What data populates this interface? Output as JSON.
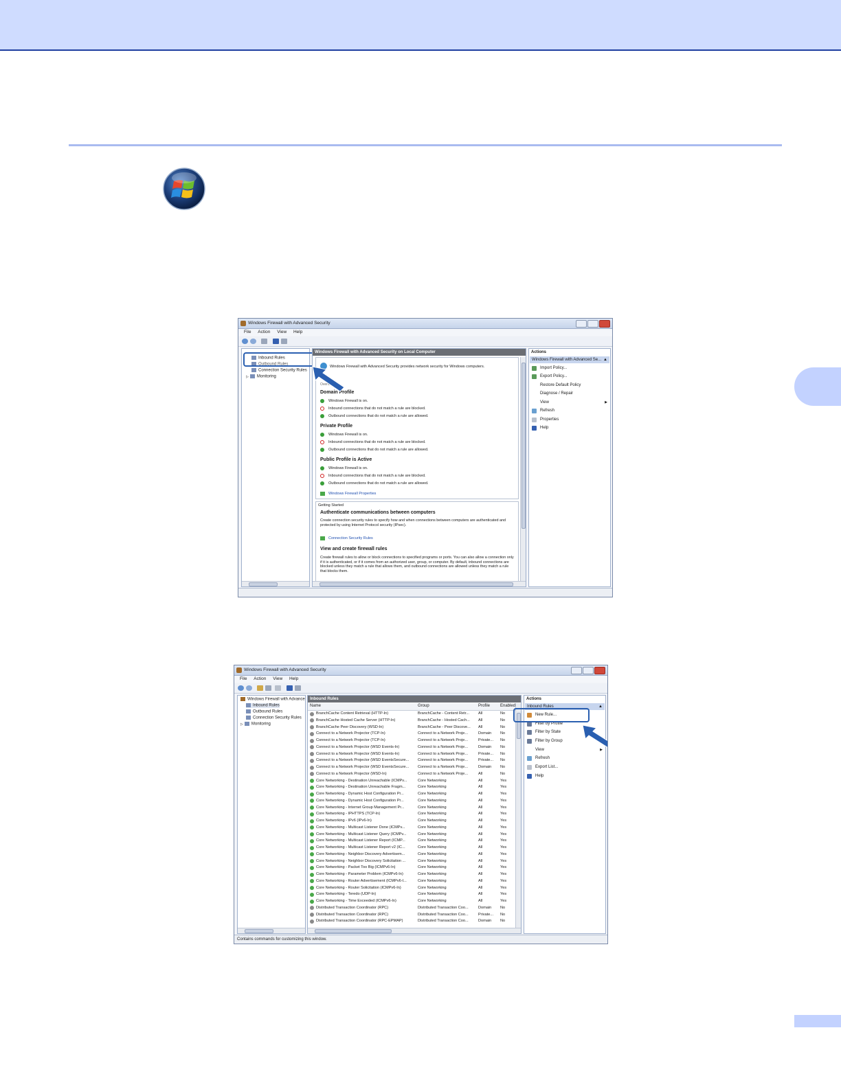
{
  "screenshot1": {
    "title": "Windows Firewall with Advanced Security",
    "menu": [
      "File",
      "Action",
      "View",
      "Help"
    ],
    "tree": {
      "inbound": "Inbound Rules",
      "outbound": "Outbound Rules",
      "connection": "Connection Security Rules",
      "monitoring": "Monitoring"
    },
    "center_header": "Windows Firewall with Advanced Security on Local Computer",
    "overview_intro": "Windows Firewall with Advanced Security provides network security for Windows computers.",
    "overview_label": "Overview",
    "profiles": [
      {
        "name": "Domain Profile",
        "lines": [
          "Windows Firewall is on.",
          "Inbound connections that do not match a rule are blocked.",
          "Outbound connections that do not match a rule are allowed."
        ]
      },
      {
        "name": "Private Profile",
        "lines": [
          "Windows Firewall is on.",
          "Inbound connections that do not match a rule are blocked.",
          "Outbound connections that do not match a rule are allowed."
        ]
      },
      {
        "name": "Public Profile is Active",
        "lines": [
          "Windows Firewall is on.",
          "Inbound connections that do not match a rule are blocked.",
          "Outbound connections that do not match a rule are allowed."
        ]
      }
    ],
    "properties_link": "Windows Firewall Properties",
    "getting_started": "Getting Started",
    "auth_title": "Authenticate communications between computers",
    "auth_text": "Create connection security rules to specify how and when connections between computers are authenticated and protected by using Internet Protocol security (IPsec).",
    "conn_link": "Connection Security Rules",
    "view_title": "View and create firewall rules",
    "view_text": "Create firewall rules to allow or block connections to specified programs or ports. You can also allow a connection only if it is authenticated, or if it comes from an authorized user, group, or computer. By default, inbound connections are blocked unless they match a rule that allows them, and outbound connections are allowed unless they match a rule that blocks them.",
    "actions_header": "Actions",
    "actions_group": "Windows Firewall with Advanced Se...",
    "actions": [
      "Import Policy...",
      "Export Policy...",
      "Restore Default Policy",
      "Diagnose / Repair",
      "View",
      "Refresh",
      "Properties",
      "Help"
    ]
  },
  "screenshot2": {
    "title": "Windows Firewall with Advanced Security",
    "menu": [
      "File",
      "Action",
      "View",
      "Help"
    ],
    "tree": {
      "root": "Windows Firewall with Advance",
      "inbound": "Inbound Rules",
      "outbound": "Outbound Rules",
      "connection": "Connection Security Rules",
      "monitoring": "Monitoring"
    },
    "center_header": "Inbound Rules",
    "columns": [
      "Name",
      "Group",
      "Profile",
      "Enabled"
    ],
    "rows": [
      {
        "n": "BranchCache Content Retrieval (HTTP-In)",
        "g": "BranchCache - Content Retr...",
        "p": "All",
        "e": "No",
        "on": false
      },
      {
        "n": "BranchCache Hosted Cache Server (HTTP-In)",
        "g": "BranchCache - Hosted Cach...",
        "p": "All",
        "e": "No",
        "on": false
      },
      {
        "n": "BranchCache Peer Discovery (WSD-In)",
        "g": "BranchCache - Peer Discove...",
        "p": "All",
        "e": "No",
        "on": false
      },
      {
        "n": "Connect to a Network Projector (TCP-In)",
        "g": "Connect to a Network Proje...",
        "p": "Domain",
        "e": "No",
        "on": false
      },
      {
        "n": "Connect to a Network Projector (TCP-In)",
        "g": "Connect to a Network Proje...",
        "p": "Private...",
        "e": "No",
        "on": false
      },
      {
        "n": "Connect to a Network Projector (WSD Events-In)",
        "g": "Connect to a Network Proje...",
        "p": "Domain",
        "e": "No",
        "on": false
      },
      {
        "n": "Connect to a Network Projector (WSD Events-In)",
        "g": "Connect to a Network Proje...",
        "p": "Private...",
        "e": "No",
        "on": false
      },
      {
        "n": "Connect to a Network Projector (WSD EventsSecure...",
        "g": "Connect to a Network Proje...",
        "p": "Private...",
        "e": "No",
        "on": false
      },
      {
        "n": "Connect to a Network Projector (WSD EventsSecure...",
        "g": "Connect to a Network Proje...",
        "p": "Domain",
        "e": "No",
        "on": false
      },
      {
        "n": "Connect to a Network Projector (WSD-In)",
        "g": "Connect to a Network Proje...",
        "p": "All",
        "e": "No",
        "on": false
      },
      {
        "n": "Core Networking - Destination Unreachable (ICMPv...",
        "g": "Core Networking",
        "p": "All",
        "e": "Yes",
        "on": true
      },
      {
        "n": "Core Networking - Destination Unreachable Fragm...",
        "g": "Core Networking",
        "p": "All",
        "e": "Yes",
        "on": true
      },
      {
        "n": "Core Networking - Dynamic Host Configuration Pr...",
        "g": "Core Networking",
        "p": "All",
        "e": "Yes",
        "on": true
      },
      {
        "n": "Core Networking - Dynamic Host Configuration Pr...",
        "g": "Core Networking",
        "p": "All",
        "e": "Yes",
        "on": true
      },
      {
        "n": "Core Networking - Internet Group Management Pr...",
        "g": "Core Networking",
        "p": "All",
        "e": "Yes",
        "on": true
      },
      {
        "n": "Core Networking - IPHTTPS (TCP-In)",
        "g": "Core Networking",
        "p": "All",
        "e": "Yes",
        "on": true
      },
      {
        "n": "Core Networking - IPv6 (IPv6-In)",
        "g": "Core Networking",
        "p": "All",
        "e": "Yes",
        "on": true
      },
      {
        "n": "Core Networking - Multicast Listener Done (ICMPv...",
        "g": "Core Networking",
        "p": "All",
        "e": "Yes",
        "on": true
      },
      {
        "n": "Core Networking - Multicast Listener Query (ICMPv...",
        "g": "Core Networking",
        "p": "All",
        "e": "Yes",
        "on": true
      },
      {
        "n": "Core Networking - Multicast Listener Report (ICMP...",
        "g": "Core Networking",
        "p": "All",
        "e": "Yes",
        "on": true
      },
      {
        "n": "Core Networking - Multicast Listener Report v2 (IC...",
        "g": "Core Networking",
        "p": "All",
        "e": "Yes",
        "on": true
      },
      {
        "n": "Core Networking - Neighbor Discovery Advertisem...",
        "g": "Core Networking",
        "p": "All",
        "e": "Yes",
        "on": true
      },
      {
        "n": "Core Networking - Neighbor Discovery Solicitation ...",
        "g": "Core Networking",
        "p": "All",
        "e": "Yes",
        "on": true
      },
      {
        "n": "Core Networking - Packet Too Big (ICMPv6-In)",
        "g": "Core Networking",
        "p": "All",
        "e": "Yes",
        "on": true
      },
      {
        "n": "Core Networking - Parameter Problem (ICMPv6-In)",
        "g": "Core Networking",
        "p": "All",
        "e": "Yes",
        "on": true
      },
      {
        "n": "Core Networking - Router Advertisement (ICMPv6-I...",
        "g": "Core Networking",
        "p": "All",
        "e": "Yes",
        "on": true
      },
      {
        "n": "Core Networking - Router Solicitation (ICMPv6-In)",
        "g": "Core Networking",
        "p": "All",
        "e": "Yes",
        "on": true
      },
      {
        "n": "Core Networking - Teredo (UDP-In)",
        "g": "Core Networking",
        "p": "All",
        "e": "Yes",
        "on": true
      },
      {
        "n": "Core Networking - Time Exceeded (ICMPv6-In)",
        "g": "Core Networking",
        "p": "All",
        "e": "Yes",
        "on": true
      },
      {
        "n": "Distributed Transaction Coordinator (RPC)",
        "g": "Distributed Transaction Coo...",
        "p": "Domain",
        "e": "No",
        "on": false
      },
      {
        "n": "Distributed Transaction Coordinator (RPC)",
        "g": "Distributed Transaction Coo...",
        "p": "Private...",
        "e": "No",
        "on": false
      },
      {
        "n": "Distributed Transaction Coordinator (RPC-EPMAP)",
        "g": "Distributed Transaction Coo...",
        "p": "Domain",
        "e": "No",
        "on": false
      }
    ],
    "actions_header": "Actions",
    "actions_group": "Inbound Rules",
    "actions": [
      "New Rule...",
      "Filter by Profile",
      "Filter by State",
      "Filter by Group",
      "View",
      "Refresh",
      "Export List...",
      "Help"
    ],
    "status": "Contains commands for customizing this window."
  }
}
